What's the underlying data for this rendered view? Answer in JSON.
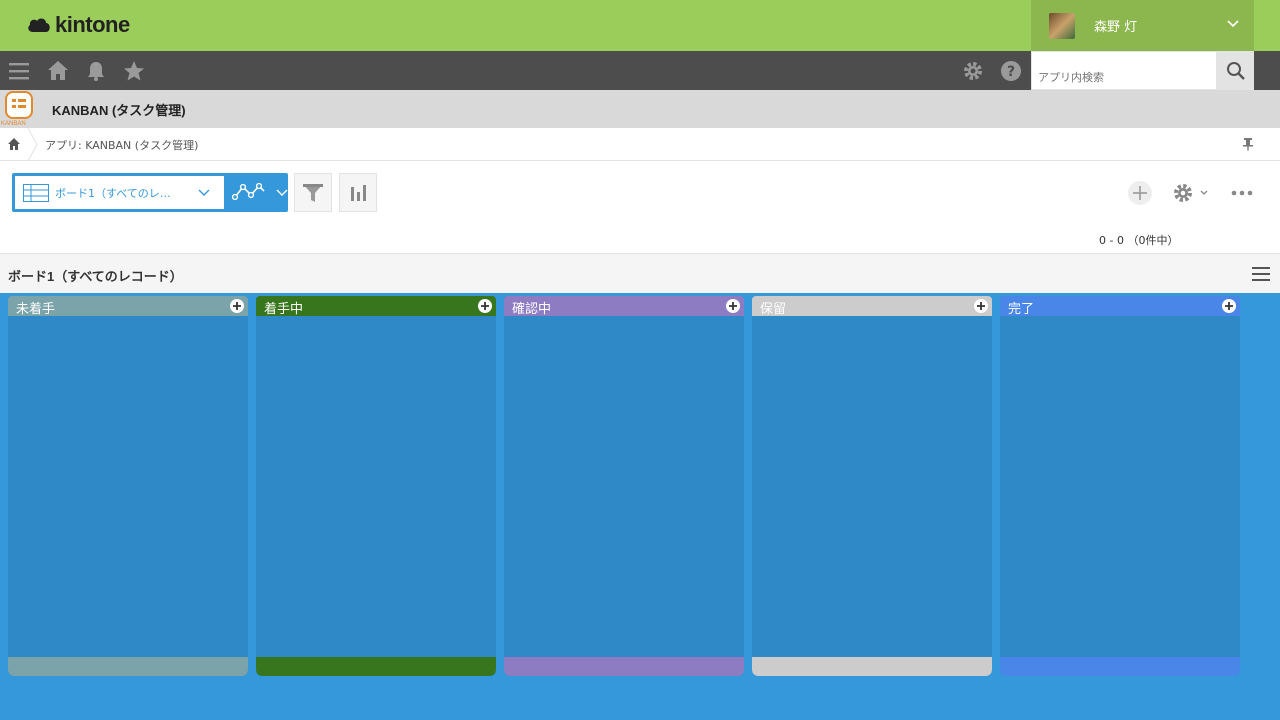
{
  "header": {
    "brand": "kintone",
    "user_name": "森野 灯"
  },
  "nav": {
    "search_placeholder": "アプリ内検索"
  },
  "app": {
    "title": "KANBAN (タスク管理)",
    "icon_label": "KANBAN",
    "breadcrumb": "アプリ: KANBAN (タスク管理)"
  },
  "toolbar": {
    "view_name": "ボード1（すべてのレ…",
    "record_count": "0 - 0 （0件中）"
  },
  "board": {
    "title": "ボード1（すべてのレコード）",
    "columns": [
      {
        "label": "未着手",
        "color": "#7ba3aa"
      },
      {
        "label": "着手中",
        "color": "#38761d"
      },
      {
        "label": "確認中",
        "color": "#8e7cc3"
      },
      {
        "label": "保留",
        "color": "#cccccc"
      },
      {
        "label": "完了",
        "color": "#4a86e8"
      }
    ]
  },
  "colors": {
    "header_green": "#9bcd5a",
    "nav_dark": "#4d4d4d",
    "accent_blue": "#3498db"
  }
}
